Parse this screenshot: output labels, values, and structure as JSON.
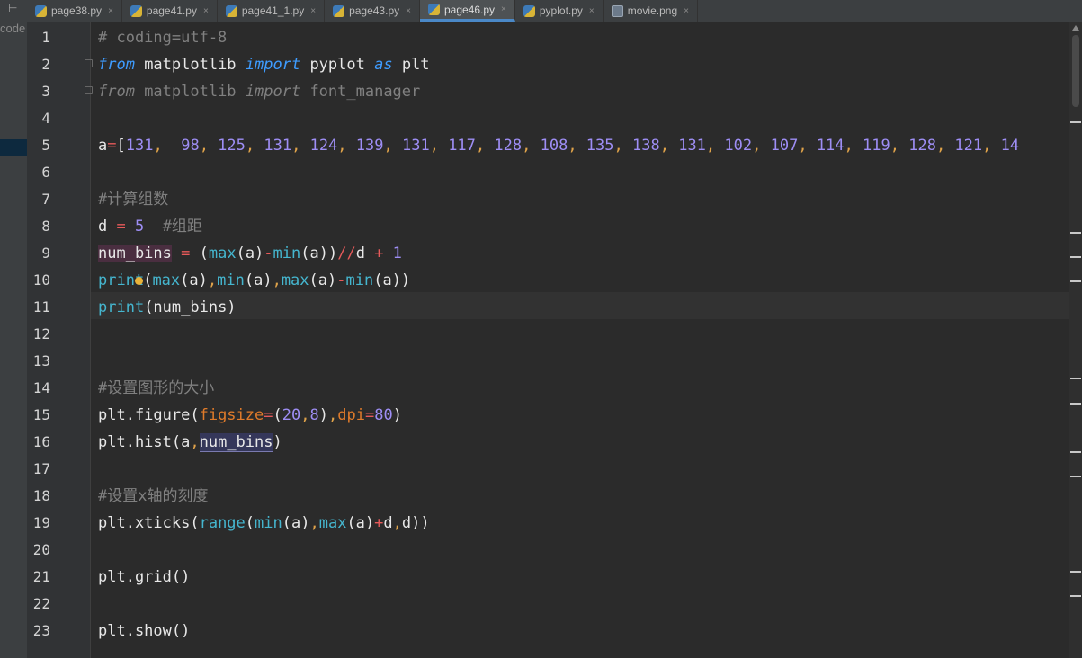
{
  "sidebar": {
    "toggle_icon": "⊢",
    "label": "code"
  },
  "tabs": [
    {
      "label": "page38.py",
      "icon": "python-file-icon",
      "active": false
    },
    {
      "label": "page41.py",
      "icon": "python-file-icon",
      "active": false
    },
    {
      "label": "page41_1.py",
      "icon": "python-file-icon",
      "active": false
    },
    {
      "label": "page43.py",
      "icon": "python-file-icon",
      "active": false
    },
    {
      "label": "page46.py",
      "icon": "python-file-icon",
      "active": true
    },
    {
      "label": "pyplot.py",
      "icon": "python-file-icon",
      "active": false
    },
    {
      "label": "movie.png",
      "icon": "image-file-icon",
      "active": false
    }
  ],
  "tab_close_glyph": "×",
  "editor": {
    "line_numbers": [
      "1",
      "2",
      "3",
      "4",
      "5",
      "6",
      "7",
      "8",
      "9",
      "10",
      "11",
      "12",
      "13",
      "14",
      "15",
      "16",
      "17",
      "18",
      "19",
      "20",
      "21",
      "22",
      "23"
    ],
    "current_line": "11",
    "code": {
      "l1": "# coding=utf-8",
      "l2_from": "from",
      "l2_mod": " matplotlib ",
      "l2_import": "import",
      "l2_name": " pyplot ",
      "l2_as": "as",
      "l2_alias": " plt",
      "l3_from": "from",
      "l3_mod": " matplotlib ",
      "l3_import": "import",
      "l3_name": " font_manager",
      "l5_var": "a",
      "l5_eq": "=",
      "l5_open": "[",
      "l5_values": [
        "131",
        "98",
        "125",
        "131",
        "124",
        "139",
        "131",
        "117",
        "128",
        "108",
        "135",
        "138",
        "131",
        "102",
        "107",
        "114",
        "119",
        "128",
        "121",
        "14"
      ],
      "l7": "#计算组数",
      "l8_var": "d",
      "l8_eq": " = ",
      "l8_num": "5",
      "l8_comment": "  #组距",
      "l9_var": "num_bins",
      "l9_eq": " = ",
      "l9_p1": "(",
      "l9_max": "max",
      "l9_a1": "(a)",
      "l9_minus": "-",
      "l9_min": "min",
      "l9_a2": "(a))",
      "l9_div": "//",
      "l9_d": "d",
      "l9_plus": " + ",
      "l9_one": "1",
      "l10_print": "print",
      "l10_rest1": "(",
      "l10_max": "max",
      "l10_a1": "(a)",
      "l10_c1": ",",
      "l10_min": "min",
      "l10_a2": "(a)",
      "l10_c2": ",",
      "l10_max2": "max",
      "l10_a3": "(a)",
      "l10_minus": "-",
      "l10_min2": "min",
      "l10_a4": "(a))",
      "l11_print": "print",
      "l11_rest": "(num_bins)",
      "l14": "#设置图形的大小",
      "l15_pre": "plt.figure(",
      "l15_k1": "figsize",
      "l15_eq1": "=",
      "l15_v1": "(20,8)",
      "l15_c": ",",
      "l15_k2": "dpi",
      "l15_eq2": "=",
      "l15_v2": "80",
      "l15_end": ")",
      "l16_pre": "plt.hist(a",
      "l16_c": ",",
      "l16_arg": "num_bins",
      "l16_end": ")",
      "l18": "#设置x轴的刻度",
      "l19_pre": "plt.xticks(",
      "l19_range": "range",
      "l19_p": "(",
      "l19_min": "min",
      "l19_a1": "(a)",
      "l19_c1": ",",
      "l19_max": "max",
      "l19_a2": "(a)",
      "l19_plus": "+",
      "l19_d": "d",
      "l19_c2": ",",
      "l19_d2": "d",
      "l19_end": "))",
      "l21": "plt.grid()",
      "l23": "plt.show()"
    }
  },
  "colors": {
    "background": "#2b2b2b",
    "comment": "#808080",
    "keyword": "#3e9cff",
    "number": "#9e8ef5",
    "operator": "#e75a5a",
    "builtin": "#45b6cf",
    "kwarg": "#e07b2a",
    "active_tab_underline": "#4a88c7"
  }
}
